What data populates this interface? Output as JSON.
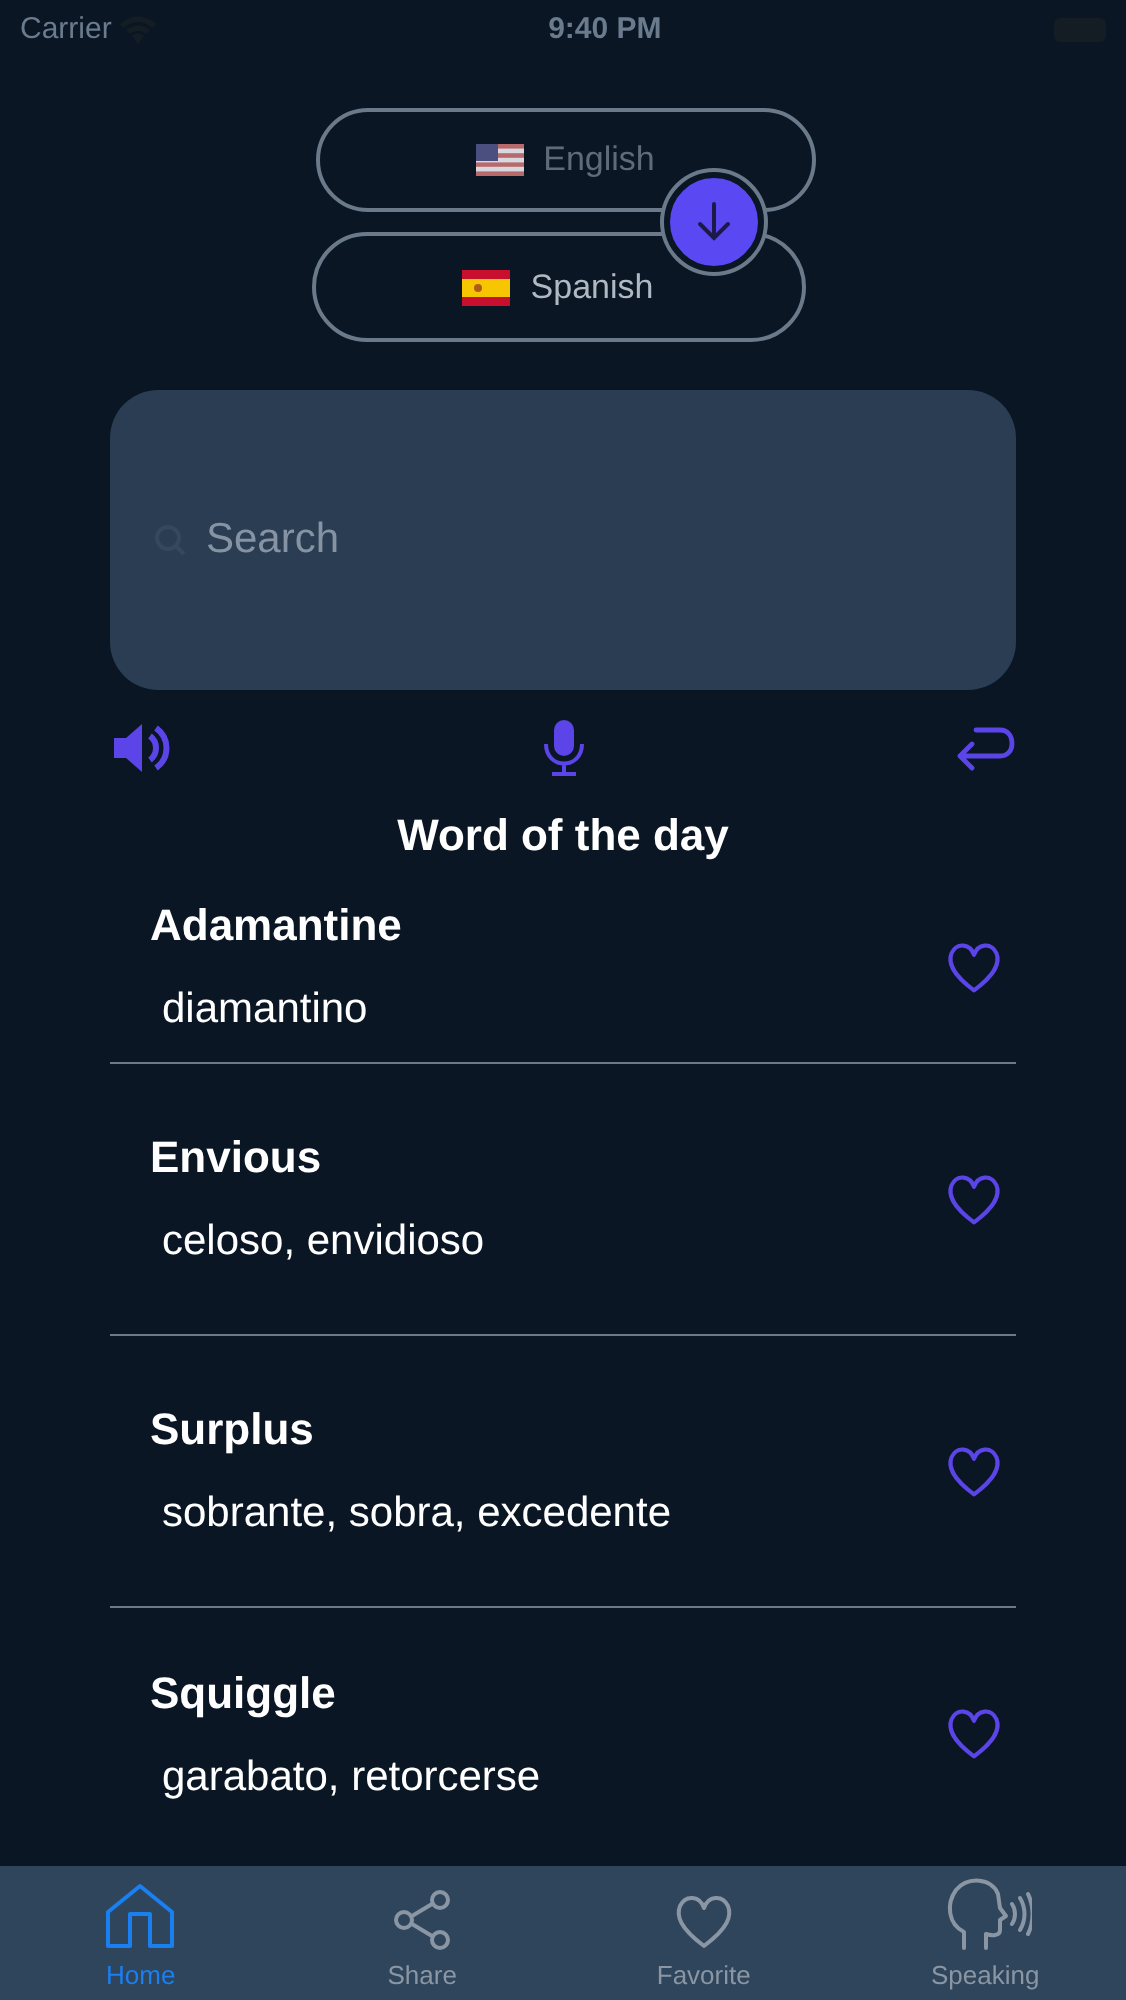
{
  "status_bar": {
    "carrier": "Carrier",
    "time": "9:40 PM"
  },
  "languages": {
    "source": "English",
    "target": "Spanish"
  },
  "search": {
    "placeholder": "Search"
  },
  "section_title": "Word of the day",
  "words": [
    {
      "word": "Adamantine",
      "translation": "diamantino"
    },
    {
      "word": "Envious",
      "translation": "celoso, envidioso"
    },
    {
      "word": "Surplus",
      "translation": "sobrante, sobra, excedente"
    },
    {
      "word": "Squiggle",
      "translation": "garabato, retorcerse"
    }
  ],
  "tabs": [
    {
      "kind": "home",
      "label": "Home",
      "selected": true
    },
    {
      "kind": "share",
      "label": "Share",
      "selected": false
    },
    {
      "kind": "favorite",
      "label": "Favorite",
      "selected": false
    },
    {
      "kind": "speaking",
      "label": "Speaking",
      "selected": false
    }
  ]
}
